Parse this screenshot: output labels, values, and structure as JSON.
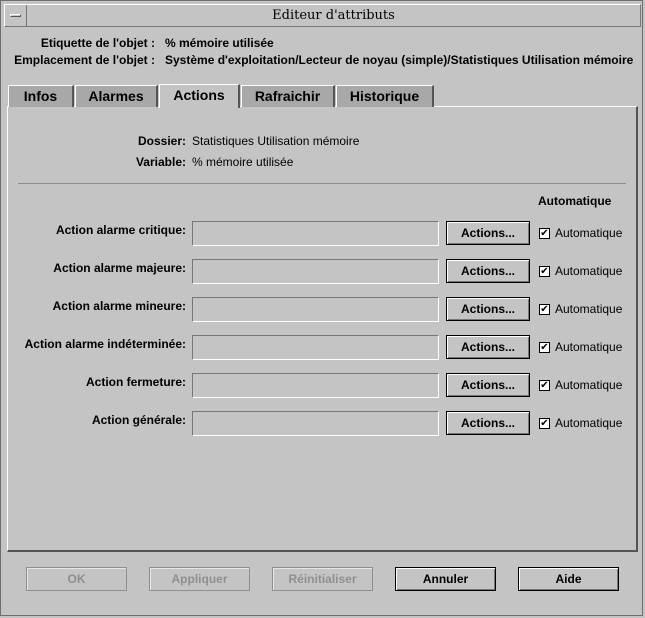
{
  "window": {
    "title": "Editeur d'attributs"
  },
  "object": {
    "label_caption": "Etiquette de l'objet :",
    "label_value": "% mémoire utilisée",
    "location_caption": "Emplacement de l'objet :",
    "location_value": "Système d'exploitation/Lecteur de noyau (simple)/Statistiques Utilisation mémoire"
  },
  "tabs": [
    {
      "label": "Infos",
      "active": false
    },
    {
      "label": "Alarmes",
      "active": false
    },
    {
      "label": "Actions",
      "active": true
    },
    {
      "label": "Rafraichir",
      "active": false
    },
    {
      "label": "Historique",
      "active": false
    }
  ],
  "details": {
    "folder_label": "Dossier:",
    "folder_value": "Statistiques Utilisation mémoire",
    "variable_label": "Variable:",
    "variable_value": "% mémoire utilisée"
  },
  "actions_header": "Automatique",
  "rows": [
    {
      "label": "Action alarme critique:",
      "value": "",
      "button": "Actions...",
      "auto_label": "Automatique",
      "auto_checked": true
    },
    {
      "label": "Action alarme majeure:",
      "value": "",
      "button": "Actions...",
      "auto_label": "Automatique",
      "auto_checked": true
    },
    {
      "label": "Action alarme mineure:",
      "value": "",
      "button": "Actions...",
      "auto_label": "Automatique",
      "auto_checked": true
    },
    {
      "label": "Action alarme indéterminée:",
      "value": "",
      "button": "Actions...",
      "auto_label": "Automatique",
      "auto_checked": true
    },
    {
      "label": "Action fermeture:",
      "value": "",
      "button": "Actions...",
      "auto_label": "Automatique",
      "auto_checked": true
    },
    {
      "label": "Action générale:",
      "value": "",
      "button": "Actions...",
      "auto_label": "Automatique",
      "auto_checked": true
    }
  ],
  "buttons": {
    "ok": "OK",
    "apply": "Appliquer",
    "reset": "Réinitialiser",
    "cancel": "Annuler",
    "help": "Aide"
  }
}
